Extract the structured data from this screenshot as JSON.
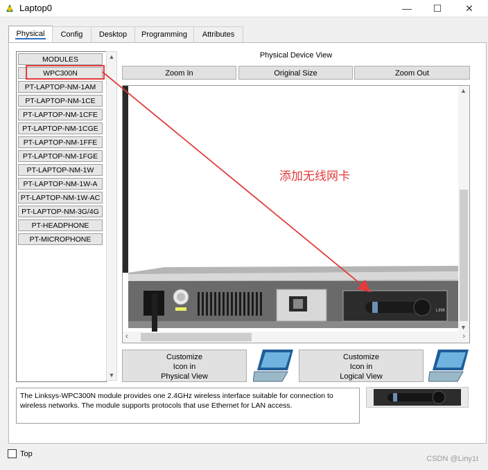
{
  "window": {
    "title": "Laptop0",
    "minimize": "—",
    "maximize": "☐",
    "close": "✕"
  },
  "tabs": [
    "Physical",
    "Config",
    "Desktop",
    "Programming",
    "Attributes"
  ],
  "modules": {
    "header": "MODULES",
    "items": [
      "WPC300N",
      "PT-LAPTOP-NM-1AM",
      "PT-LAPTOP-NM-1CE",
      "PT-LAPTOP-NM-1CFE",
      "PT-LAPTOP-NM-1CGE",
      "PT-LAPTOP-NM-1FFE",
      "PT-LAPTOP-NM-1FGE",
      "PT-LAPTOP-NM-1W",
      "PT-LAPTOP-NM-1W-A",
      "PT-LAPTOP-NM-1W-AC",
      "PT-LAPTOP-NM-3G/4G",
      "PT-HEADPHONE",
      "PT-MICROPHONE"
    ],
    "selected_index": 0
  },
  "device_view": {
    "title": "Physical Device View",
    "zoom_in": "Zoom In",
    "original_size": "Original Size",
    "zoom_out": "Zoom Out",
    "annotation": "添加无线网卡",
    "port_label": "LINK"
  },
  "customize": {
    "physical": {
      "l1": "Customize",
      "l2": "Icon in",
      "l3": "Physical View"
    },
    "logical": {
      "l1": "Customize",
      "l2": "Icon in",
      "l3": "Logical View"
    }
  },
  "description": "The Linksys-WPC300N module provides one 2.4GHz wireless interface suitable for connection to wireless networks. The module supports protocols that use Ethernet for LAN access.",
  "footer": {
    "top_label": "Top",
    "watermark": "CSDN @Liny1t"
  },
  "colors": {
    "annotation": "#e23b3b",
    "tab_accent": "#2c6fc1"
  }
}
